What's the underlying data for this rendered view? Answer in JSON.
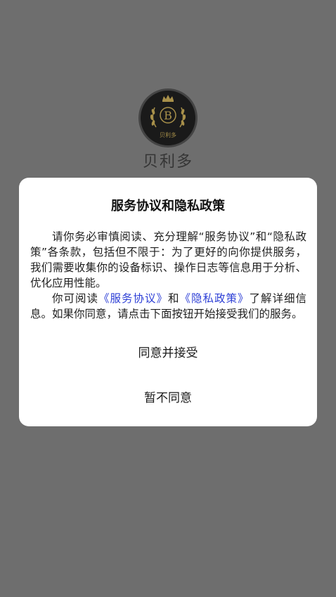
{
  "app": {
    "name": "贝利多",
    "logo_letter": "B",
    "logo_caption": "贝利多"
  },
  "dialog": {
    "title": "服务协议和隐私政策",
    "para1": "请你务必审慎阅读、充分理解“服务协议”和“隐私政策”各条款，包括但不限于：为了更好的向你提供服务，我们需要收集你的设备标识、操作日志等信息用于分析、优化应用性能。",
    "para2_prefix": "你可阅读",
    "service_link": "《服务协议》",
    "para2_and": "和",
    "privacy_link": "《隐私政策》",
    "para2_suffix": "了解详细信息。如果你同意，请点击下面按钮开始接受我们的服务。",
    "agree_label": "同意并接受",
    "disagree_label": "暂不同意"
  },
  "colors": {
    "overlay": "#6e6e6e",
    "link": "#2d3fd6",
    "logo_gold": "#a8904a"
  },
  "icons": {
    "logo": "crown-laurel-b-emblem"
  }
}
